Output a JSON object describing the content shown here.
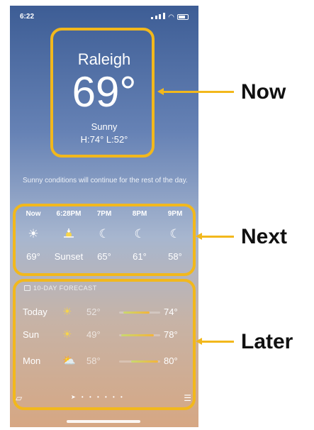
{
  "status_bar": {
    "time": "6:22"
  },
  "current": {
    "city": "Raleigh",
    "temperature": "69°",
    "condition": "Sunny",
    "high_low": "H:74°  L:52°"
  },
  "summary": "Sunny conditions will continue for the rest of the day.",
  "hourly": [
    {
      "time": "Now",
      "icon": "sun-icon",
      "glyph": "☀",
      "value": "69°"
    },
    {
      "time": "6:28PM",
      "icon": "sunset-icon",
      "glyph": "🌅",
      "value": "Sunset"
    },
    {
      "time": "7PM",
      "icon": "moon-stars-icon",
      "glyph": "☾",
      "value": "65°"
    },
    {
      "time": "8PM",
      "icon": "moon-stars-icon",
      "glyph": "☾",
      "value": "61°"
    },
    {
      "time": "9PM",
      "icon": "moon-stars-icon",
      "glyph": "☾",
      "value": "58°"
    }
  ],
  "forecast_header": "10-DAY FORECAST",
  "forecast": [
    {
      "day": "Today",
      "icon": "sun-icon",
      "glyph": "☀",
      "low": "52°",
      "high": "74°",
      "range_start": 0.1,
      "range_end": 0.75
    },
    {
      "day": "Sun",
      "icon": "sun-icon",
      "glyph": "☀",
      "low": "49°",
      "high": "78°",
      "range_start": 0.05,
      "range_end": 0.85
    },
    {
      "day": "Mon",
      "icon": "partly-cloudy-icon",
      "glyph": "⛅",
      "low": "58°",
      "high": "80°",
      "range_start": 0.3,
      "range_end": 0.95
    }
  ],
  "annotations": {
    "now": "Now",
    "next": "Next",
    "later": "Later"
  },
  "colors": {
    "highlight": "#f2b81c"
  }
}
